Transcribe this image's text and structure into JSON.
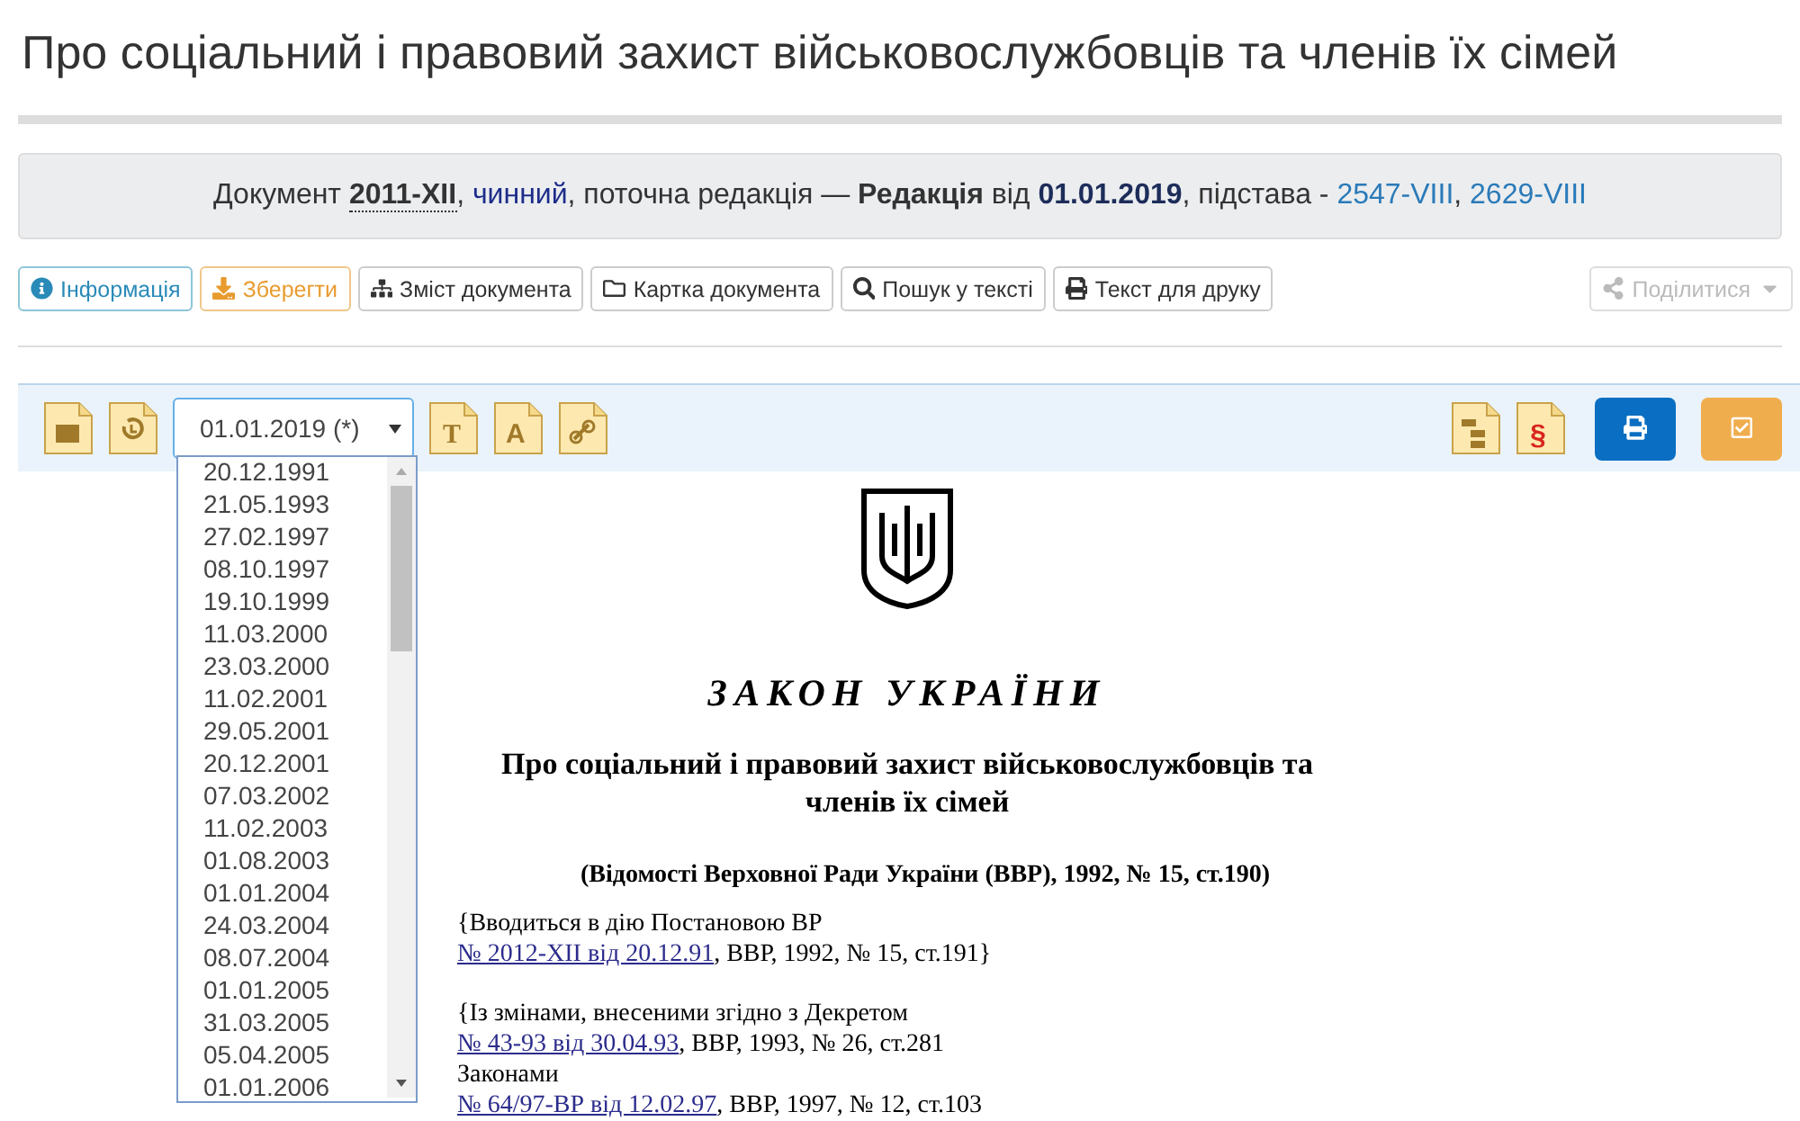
{
  "title": "Про соціальний і правовий захист військовослужбовців та членів їх сімей",
  "info_bar": [
    {
      "kind": "text",
      "text": "Документ "
    },
    {
      "kind": "doc",
      "text": "2011-XII"
    },
    {
      "kind": "text",
      "text": ", "
    },
    {
      "kind": "status",
      "text": "чинний"
    },
    {
      "kind": "text",
      "text": ", поточна редакція — "
    },
    {
      "kind": "bold",
      "text": "Редакція"
    },
    {
      "kind": "text",
      "text": " від "
    },
    {
      "kind": "date",
      "text": "01.01.2019"
    },
    {
      "kind": "text",
      "text": ", підстава - "
    },
    {
      "kind": "link",
      "text": "2547-VIII"
    },
    {
      "kind": "text",
      "text": ", "
    },
    {
      "kind": "link",
      "text": "2629-VIII"
    }
  ],
  "actions": [
    {
      "kind": "info",
      "label": "Інформація"
    },
    {
      "kind": "save",
      "label": "Зберегти"
    },
    {
      "kind": "contents",
      "label": "Зміст документа"
    },
    {
      "kind": "card",
      "label": "Картка документа"
    },
    {
      "kind": "search",
      "label": "Пошук у тексті"
    },
    {
      "kind": "print",
      "label": "Текст для друку"
    }
  ],
  "share": {
    "label": "Поділитися",
    "disabled": true
  },
  "tool_glyphs": {
    "text": "T",
    "font": "A",
    "paragraph": "§"
  },
  "edition_select": {
    "value": "01.01.2019 (*)",
    "options": [
      "20.12.1991",
      "21.05.1993",
      "27.02.1997",
      "08.10.1997",
      "19.10.1999",
      "11.03.2000",
      "23.03.2000",
      "11.02.2001",
      "29.05.2001",
      "20.12.2001",
      "07.03.2002",
      "11.02.2003",
      "01.08.2003",
      "01.01.2004",
      "24.03.2004",
      "08.07.2004",
      "01.01.2005",
      "31.03.2005",
      "05.04.2005",
      "01.01.2006"
    ]
  },
  "document": {
    "heading": "ЗАКОН УКРАЇНИ",
    "name": "Про соціальний і правовий захист військовослужбовців та членів їх сімей",
    "source": "(Відомості Верховної Ради України (ВВР), 1992, № 15, ст.190)",
    "paragraphs": [
      [
        {
          "kind": "text",
          "text": "{Вводиться в дію Постановою ВР"
        },
        {
          "kind": "break"
        },
        {
          "kind": "link",
          "text": "№ 2012-XII від 20.12.91"
        },
        {
          "kind": "text",
          "text": ", ВВР, 1992, № 15, ст.191}"
        }
      ],
      [
        {
          "kind": "text",
          "text": "{Із змінами, внесеними згідно з Декретом"
        },
        {
          "kind": "break"
        },
        {
          "kind": "link",
          "text": "№ 43-93 від 30.04.93"
        },
        {
          "kind": "text",
          "text": ", ВВР, 1993, № 26, ст.281"
        },
        {
          "kind": "break"
        },
        {
          "kind": "text",
          "text": "Законами"
        },
        {
          "kind": "break"
        },
        {
          "kind": "link",
          "text": "№ 64/97-ВР від 12.02.97"
        },
        {
          "kind": "text",
          "text": ", ВВР, 1997, № 12, ст.103"
        }
      ]
    ]
  }
}
